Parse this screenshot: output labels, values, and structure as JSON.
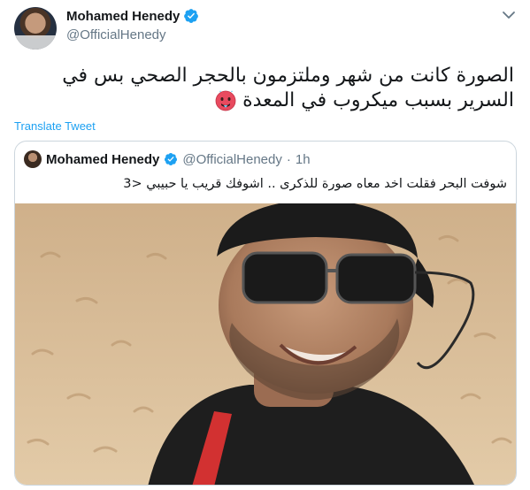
{
  "tweet": {
    "author": {
      "display_name": "Mohamed Henedy",
      "handle": "@OfficialHenedy",
      "verified": true
    },
    "text_lines": [
      "الصورة كانت من شهر وملتزمون بالحجر الصحي  بس في",
      "السرير بسبب ميكروب في المعدة"
    ],
    "emoji": "hot-face-emoji",
    "translate_label": "Translate Tweet"
  },
  "quoted_tweet": {
    "author": {
      "display_name": "Mohamed Henedy",
      "handle": "@OfficialHenedy",
      "verified": true
    },
    "separator": "·",
    "time": "1h",
    "text": "شوفت البحر فقلت اخد معاه صورة للذكرى .. اشوفك قريب يا حبيبي <3",
    "media": "selfie-photo-on-beach"
  },
  "colors": {
    "link": "#1da1f2",
    "verified": "#1da1f2",
    "secondary_text": "#657786",
    "border": "#ccd6dd"
  }
}
